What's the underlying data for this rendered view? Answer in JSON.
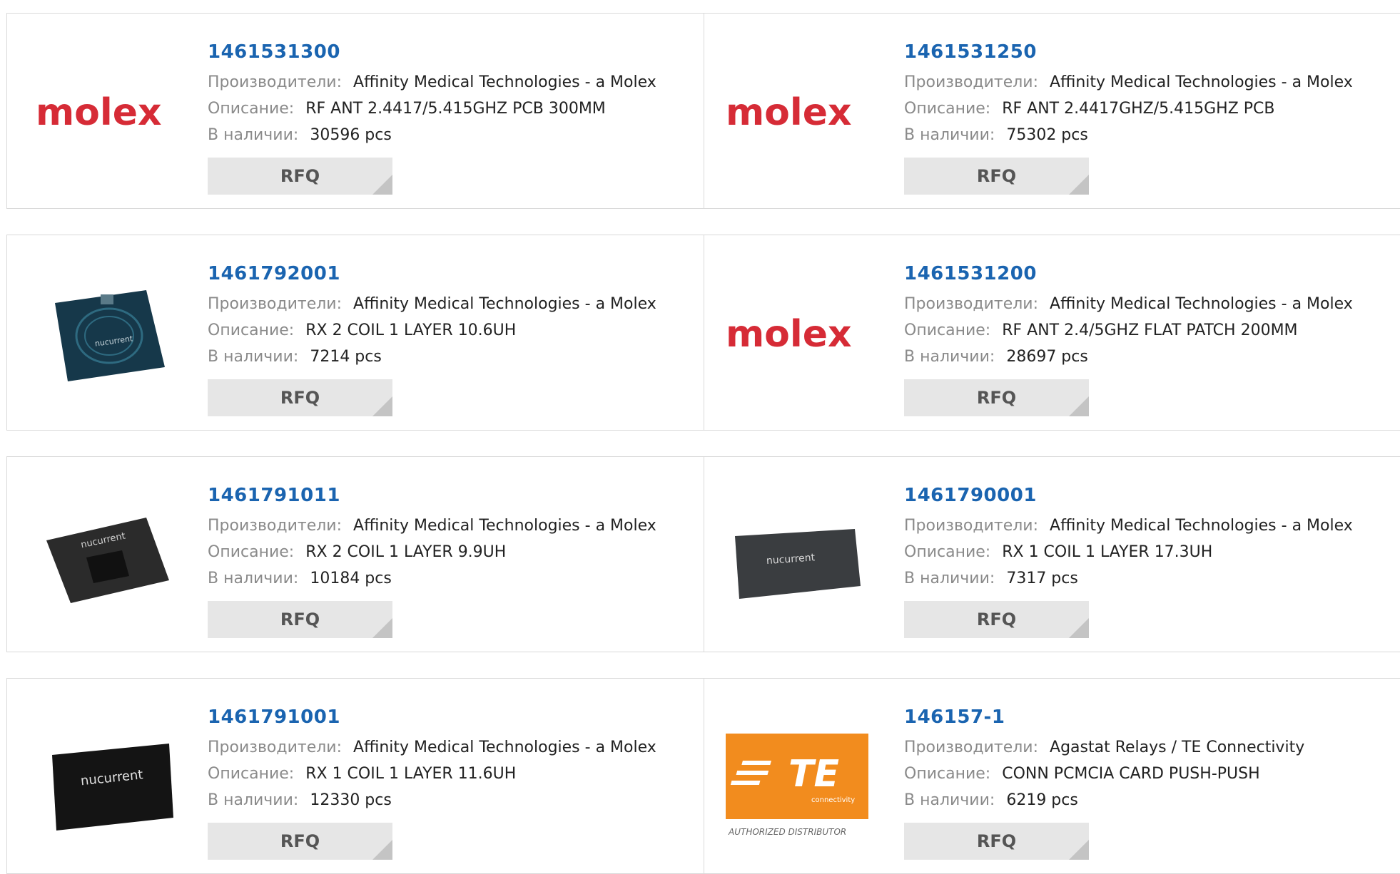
{
  "labels": {
    "manufacturer": "Производители:",
    "description": "Описание:",
    "stock": "В наличии:",
    "rfq": "RFQ"
  },
  "products": [
    {
      "part": "1461531300",
      "manufacturer": "Affinity Medical Technologies - a Molex",
      "description": "RF ANT 2.4417/5.415GHZ PCB 300MM",
      "stock": "30596 pcs",
      "image": "molex-logo",
      "logo_text": "molex"
    },
    {
      "part": "1461531250",
      "manufacturer": "Affinity Medical Technologies - a Molex",
      "description": "RF ANT 2.4417GHZ/5.415GHZ PCB",
      "stock": "75302 pcs",
      "image": "molex-logo",
      "logo_text": "molex"
    },
    {
      "part": "1461792001",
      "manufacturer": "Affinity Medical Technologies - a Molex",
      "description": "RX 2 COIL 1 LAYER 10.6UH",
      "stock": "7214 pcs",
      "image": "coil-board-blue",
      "logo_text": "nucurrent"
    },
    {
      "part": "1461531200",
      "manufacturer": "Affinity Medical Technologies - a Molex",
      "description": "RF ANT 2.4/5GHZ FLAT PATCH 200MM",
      "stock": "28697 pcs",
      "image": "molex-logo",
      "logo_text": "molex"
    },
    {
      "part": "1461791011",
      "manufacturer": "Affinity Medical Technologies - a Molex",
      "description": "RX 2 COIL 1 LAYER 9.9UH",
      "stock": "10184 pcs",
      "image": "coil-board-dark",
      "logo_text": "nucurrent"
    },
    {
      "part": "1461790001",
      "manufacturer": "Affinity Medical Technologies - a Molex",
      "description": "RX 1 COIL 1 LAYER 17.3UH",
      "stock": "7317 pcs",
      "image": "coil-board-grey",
      "logo_text": "nucurrent"
    },
    {
      "part": "1461791001",
      "manufacturer": "Affinity Medical Technologies - a Molex",
      "description": "RX 1 COIL 1 LAYER 11.6UH",
      "stock": "12330 pcs",
      "image": "coil-board-black",
      "logo_text": "nucurrent"
    },
    {
      "part": "146157-1",
      "manufacturer": "Agastat Relays / TE Connectivity",
      "description": "CONN PCMCIA CARD PUSH-PUSH",
      "stock": "6219 pcs",
      "image": "te-logo",
      "logo_text": "TE",
      "logo_subtext": "connectivity",
      "logo_caption": "AUTHORIZED DISTRIBUTOR"
    }
  ],
  "colors": {
    "part_link": "#1a64b0",
    "molex_red": "#d62b36",
    "te_orange": "#f28c1e"
  }
}
